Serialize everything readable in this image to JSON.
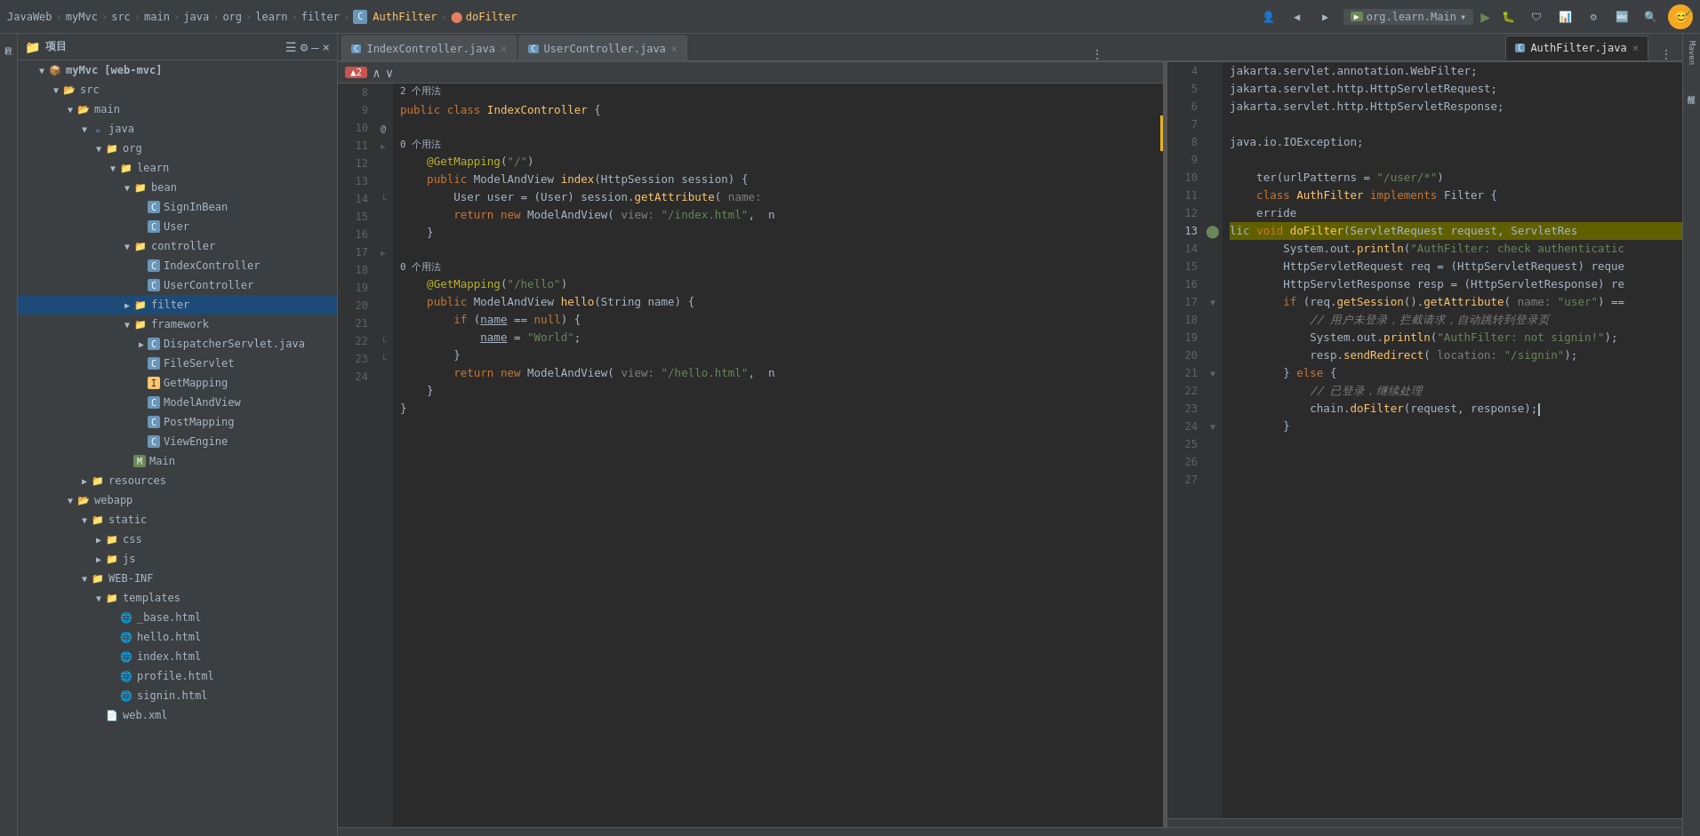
{
  "topbar": {
    "breadcrumbs": [
      "JavaWeb",
      "myMvc",
      "src",
      "main",
      "java",
      "org",
      "learn",
      "filter"
    ],
    "file": "AuthFilter",
    "method": "doFilter",
    "run_config": "org.learn.Main"
  },
  "project_panel": {
    "title": "项目",
    "tree": [
      {
        "id": "myMvc",
        "label": "myMvc [web-mvc]",
        "indent": 0,
        "type": "module",
        "expanded": true
      },
      {
        "id": "src",
        "label": "src",
        "indent": 1,
        "type": "folder",
        "expanded": true
      },
      {
        "id": "main",
        "label": "main",
        "indent": 2,
        "type": "folder",
        "expanded": true
      },
      {
        "id": "java",
        "label": "java",
        "indent": 3,
        "type": "java",
        "expanded": true
      },
      {
        "id": "org",
        "label": "org",
        "indent": 4,
        "type": "pkg",
        "expanded": true
      },
      {
        "id": "learn",
        "label": "learn",
        "indent": 5,
        "type": "pkg",
        "expanded": true
      },
      {
        "id": "bean",
        "label": "bean",
        "indent": 6,
        "type": "pkg",
        "expanded": true
      },
      {
        "id": "SignInBean",
        "label": "SignInBean",
        "indent": 7,
        "type": "class"
      },
      {
        "id": "User",
        "label": "User",
        "indent": 7,
        "type": "class"
      },
      {
        "id": "controller",
        "label": "controller",
        "indent": 6,
        "type": "pkg",
        "expanded": true
      },
      {
        "id": "IndexController",
        "label": "IndexController",
        "indent": 7,
        "type": "class"
      },
      {
        "id": "UserController",
        "label": "UserController",
        "indent": 7,
        "type": "class"
      },
      {
        "id": "filter",
        "label": "filter",
        "indent": 6,
        "type": "pkg",
        "expanded": false,
        "selected": true
      },
      {
        "id": "framework",
        "label": "framework",
        "indent": 6,
        "type": "pkg",
        "expanded": true
      },
      {
        "id": "DispatcherServlet",
        "label": "DispatcherServlet.java",
        "indent": 7,
        "type": "class"
      },
      {
        "id": "FileServlet",
        "label": "FileServlet",
        "indent": 7,
        "type": "class"
      },
      {
        "id": "GetMapping",
        "label": "GetMapping",
        "indent": 7,
        "type": "iface"
      },
      {
        "id": "ModelAndView",
        "label": "ModelAndView",
        "indent": 7,
        "type": "class"
      },
      {
        "id": "PostMapping",
        "label": "PostMapping",
        "indent": 7,
        "type": "class"
      },
      {
        "id": "ViewEngine",
        "label": "ViewEngine",
        "indent": 7,
        "type": "class"
      },
      {
        "id": "Main",
        "label": "Main",
        "indent": 6,
        "type": "main"
      },
      {
        "id": "resources",
        "label": "resources",
        "indent": 3,
        "type": "folder"
      },
      {
        "id": "webapp",
        "label": "webapp",
        "indent": 2,
        "type": "folder",
        "expanded": true
      },
      {
        "id": "static",
        "label": "static",
        "indent": 3,
        "type": "folder",
        "expanded": true
      },
      {
        "id": "css",
        "label": "css",
        "indent": 4,
        "type": "folder"
      },
      {
        "id": "js",
        "label": "js",
        "indent": 4,
        "type": "folder"
      },
      {
        "id": "WEB-INF",
        "label": "WEB-INF",
        "indent": 3,
        "type": "folder",
        "expanded": true
      },
      {
        "id": "templates",
        "label": "templates",
        "indent": 4,
        "type": "folder",
        "expanded": true
      },
      {
        "id": "_base.html",
        "label": "_base.html",
        "indent": 5,
        "type": "html"
      },
      {
        "id": "hello.html",
        "label": "hello.html",
        "indent": 5,
        "type": "html"
      },
      {
        "id": "index.html",
        "label": "index.html",
        "indent": 5,
        "type": "html"
      },
      {
        "id": "profile.html",
        "label": "profile.html",
        "indent": 5,
        "type": "html"
      },
      {
        "id": "signin.html",
        "label": "signin.html",
        "indent": 5,
        "type": "html"
      },
      {
        "id": "web.xml",
        "label": "web.xml",
        "indent": 4,
        "type": "xml"
      }
    ]
  },
  "left_editor": {
    "tab": "IndexController.java",
    "warning_count": "2",
    "usage_hint": "2 个用法",
    "lines": [
      {
        "num": 8,
        "content": "public class IndexController {",
        "type": "normal"
      },
      {
        "num": 9,
        "content": "",
        "type": "normal"
      },
      {
        "num": 10,
        "content": "    @GetMapping(\"/\")",
        "type": "normal",
        "usage": "0 个用法"
      },
      {
        "num": 11,
        "content": "    public ModelAndView index(HttpSession session) {",
        "type": "normal"
      },
      {
        "num": 12,
        "content": "        User user = (User) session.getAttribute( name:",
        "type": "normal"
      },
      {
        "num": 13,
        "content": "        return new ModelAndView( view: \"/index.html\",  n",
        "type": "normal"
      },
      {
        "num": 14,
        "content": "    }",
        "type": "normal"
      },
      {
        "num": 15,
        "content": "",
        "type": "normal"
      },
      {
        "num": 16,
        "content": "    @GetMapping(\"/hello\")",
        "type": "normal",
        "usage": "0 个用法"
      },
      {
        "num": 17,
        "content": "    public ModelAndView hello(String name) {",
        "type": "normal"
      },
      {
        "num": 18,
        "content": "        if (name == null) {",
        "type": "normal"
      },
      {
        "num": 19,
        "content": "            name = \"World\";",
        "type": "normal"
      },
      {
        "num": 20,
        "content": "        }",
        "type": "normal"
      },
      {
        "num": 21,
        "content": "        return new ModelAndView( view: \"/hello.html\",  n",
        "type": "normal"
      },
      {
        "num": 22,
        "content": "    }",
        "type": "normal"
      },
      {
        "num": 23,
        "content": "}",
        "type": "normal"
      },
      {
        "num": 24,
        "content": "",
        "type": "normal"
      }
    ]
  },
  "right_editor": {
    "tab": "AuthFilter.java",
    "lines": [
      {
        "num": 4,
        "code": "jakarta.servlet.annotation.WebFilter;"
      },
      {
        "num": 5,
        "code": "jakarta.servlet.http.HttpServletRequest;"
      },
      {
        "num": 6,
        "code": "jakarta.servlet.http.HttpServletResponse;"
      },
      {
        "num": 7,
        "code": ""
      },
      {
        "num": 8,
        "code": "java.io.IOException;"
      },
      {
        "num": 9,
        "code": ""
      },
      {
        "num": 10,
        "code": "    ter(urlPatterns = \"/user/*\")"
      },
      {
        "num": 11,
        "code": "    class AuthFilter implements Filter {"
      },
      {
        "num": 12,
        "code": "    erride"
      },
      {
        "num": 13,
        "code": "lic void doFilter(ServletRequest request, ServletRes"
      },
      {
        "num": 14,
        "code": "        System.out.println(\"AuthFilter: check authenticatic"
      },
      {
        "num": 15,
        "code": "        HttpServletRequest req = (HttpServletRequest) reque"
      },
      {
        "num": 16,
        "code": "        HttpServletResponse resp = (HttpServletResponse) re"
      },
      {
        "num": 17,
        "code": "        if (req.getSession().getAttribute( name: \"user\") =="
      },
      {
        "num": 18,
        "code": "            // 用户未登录，拦截请求，自动跳转到登录页"
      },
      {
        "num": 19,
        "code": "            System.out.println(\"AuthFilter: not signin!\");"
      },
      {
        "num": 20,
        "code": "            resp.sendRedirect( location: \"/signin\");"
      },
      {
        "num": 21,
        "code": "        } else {"
      },
      {
        "num": 22,
        "code": "            // 已登录，继续处理"
      },
      {
        "num": 23,
        "code": "            chain.doFilter(request, response);"
      },
      {
        "num": 24,
        "code": "        }"
      },
      {
        "num": 25,
        "code": ""
      },
      {
        "num": 26,
        "code": ""
      },
      {
        "num": 27,
        "code": ""
      }
    ]
  }
}
